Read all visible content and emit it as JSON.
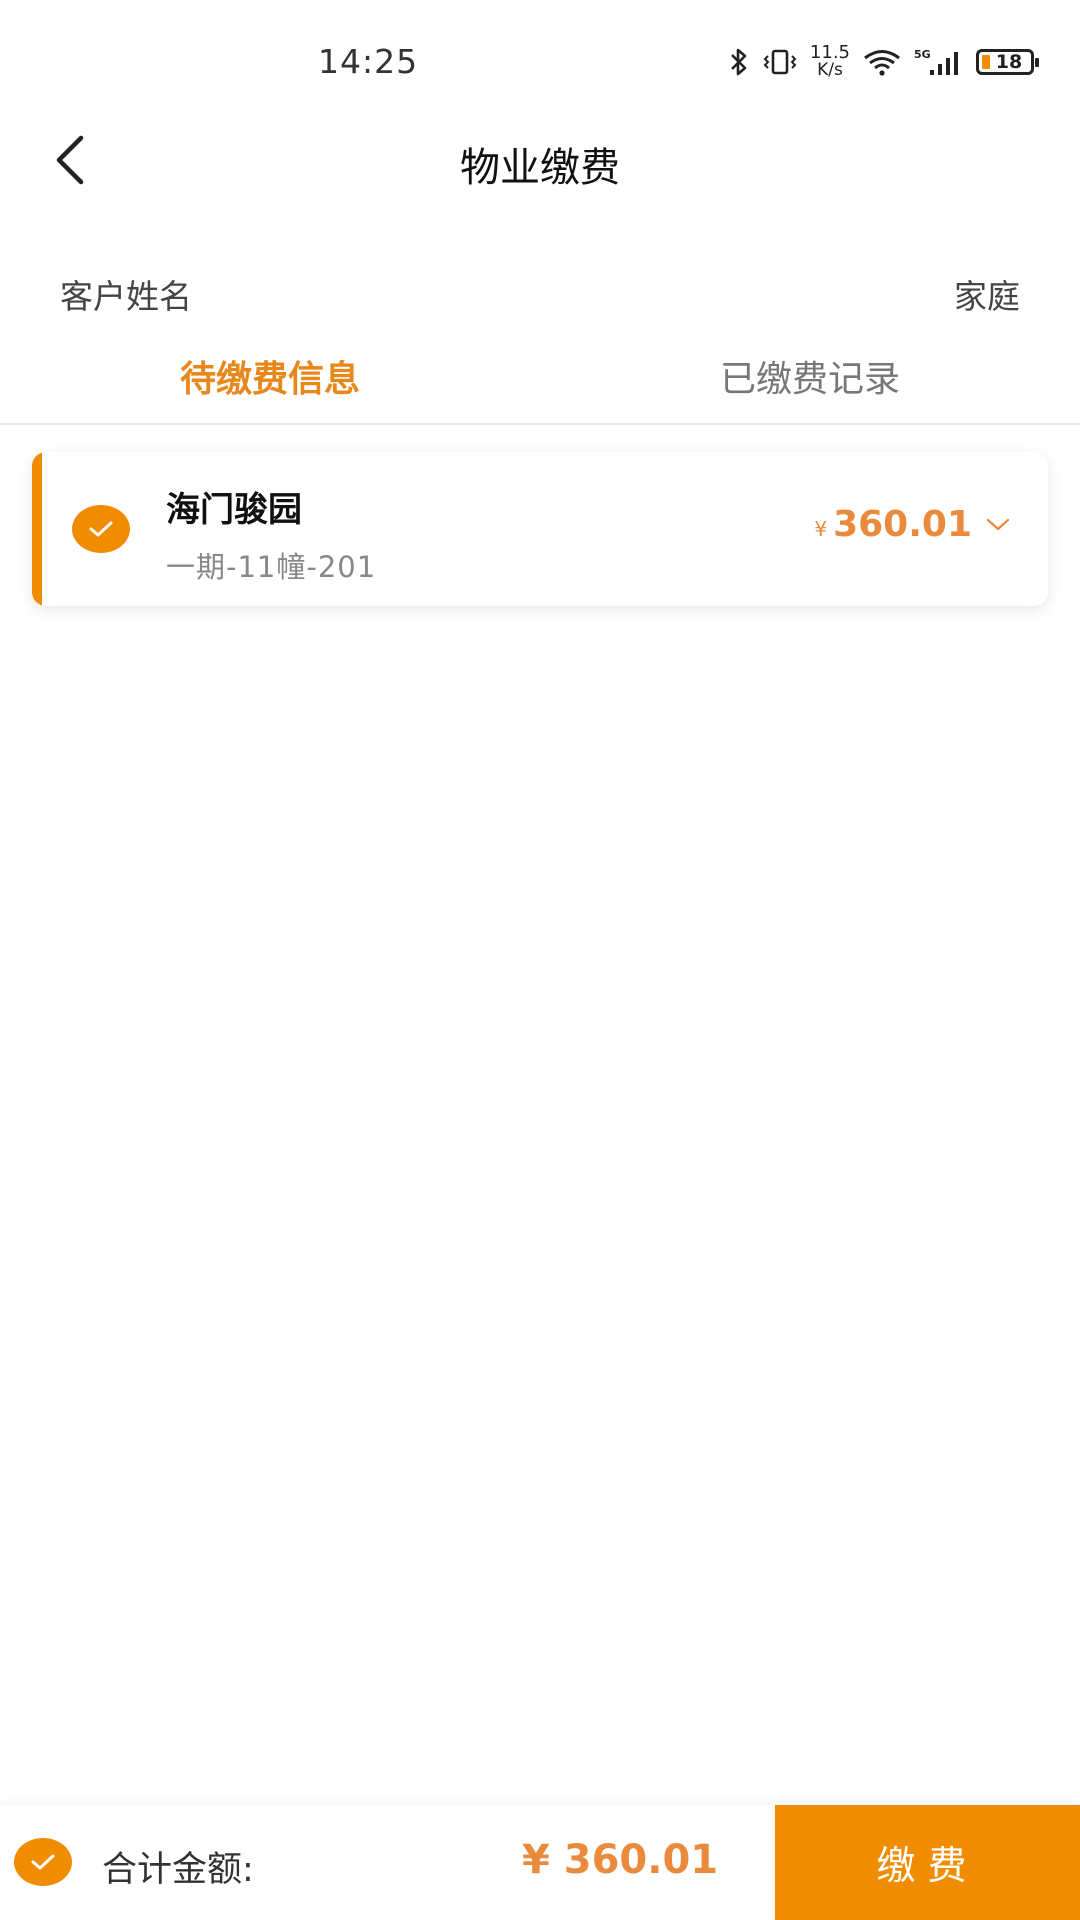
{
  "status_bar": {
    "time": "14:25",
    "net_speed_value": "11.5",
    "net_speed_unit": "K/s",
    "network_type": "5G",
    "battery_level": "18"
  },
  "nav": {
    "title": "物业缴费",
    "back_icon": "chevron-left-icon"
  },
  "customer": {
    "name_label": "客户姓名",
    "type_label": "家庭"
  },
  "tabs": [
    {
      "label": "待缴费信息",
      "active": true
    },
    {
      "label": "已缴费记录",
      "active": false
    }
  ],
  "bills": [
    {
      "community": "海门骏园",
      "unit": "一期-11幢-201",
      "currency": "¥",
      "amount": "360.01",
      "selected": true
    }
  ],
  "footer": {
    "total_label": "合计金额:",
    "total_amount": "¥ 360.01",
    "pay_button": "缴费",
    "select_all_checked": true
  },
  "colors": {
    "accent": "#f08c00",
    "amount": "#e98a3c",
    "active_tab": "#e8871a"
  }
}
